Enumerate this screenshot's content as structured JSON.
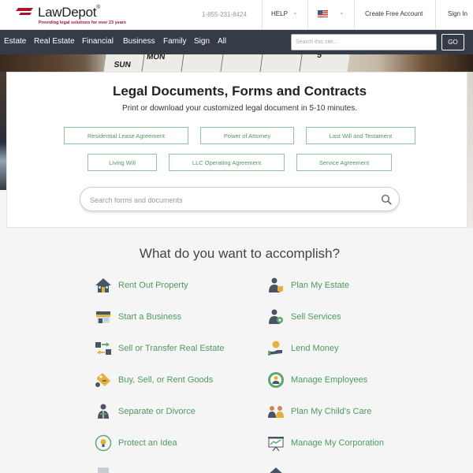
{
  "header": {
    "logo_name": "LawDepot",
    "logo_reg": "®",
    "logo_tagline": "Providing legal solutions for over 23 years",
    "phone": "1-855-231-8424",
    "help_label": "HELP",
    "country_flag": "us-flag-icon",
    "create_account_label": "Create Free Account",
    "sign_in_label": "Sign In",
    "brand_color": "#a3192e"
  },
  "nav": {
    "items": [
      "Estate",
      "Real Estate",
      "Financial",
      "Business",
      "Family",
      "Sign",
      "All"
    ],
    "search_placeholder": "Search this site...",
    "go_label": "GO",
    "bar_color": "#363b48"
  },
  "hero": {
    "calendar_days": [
      "SUN",
      "MON",
      "5"
    ],
    "title": "Legal Documents, Forms and Contracts",
    "subtitle": "Print or download your customized legal document in 5-10 minutes.",
    "quick_links": [
      "Residential Lease Agreement",
      "Power of Attorney",
      "Last Will and Testament",
      "Living Will",
      "LLC Operating Agreement",
      "Service Agreement"
    ],
    "search_placeholder": "Search forms and documents",
    "accent_color": "#4f9a60"
  },
  "accomplish": {
    "title": "What do you want to accomplish?",
    "tasks_left": [
      {
        "label": "Rent Out Property",
        "icon": "house-icon"
      },
      {
        "label": "Start a Business",
        "icon": "storefront-icon"
      },
      {
        "label": "Sell or Transfer Real Estate",
        "icon": "transfer-arrows-icon"
      },
      {
        "label": "Buy, Sell, or Rent Goods",
        "icon": "price-tag-icon"
      },
      {
        "label": "Separate or Divorce",
        "icon": "separate-person-icon"
      },
      {
        "label": "Protect an Idea",
        "icon": "lightbulb-icon"
      }
    ],
    "tasks_right": [
      {
        "label": "Plan My Estate",
        "icon": "estate-person-icon"
      },
      {
        "label": "Sell Services",
        "icon": "services-person-icon"
      },
      {
        "label": "Lend Money",
        "icon": "money-hand-icon"
      },
      {
        "label": "Manage Employees",
        "icon": "employees-icon"
      },
      {
        "label": "Plan My Child's Care",
        "icon": "family-icon"
      },
      {
        "label": "Manage My Corporation",
        "icon": "presentation-board-icon"
      }
    ]
  }
}
